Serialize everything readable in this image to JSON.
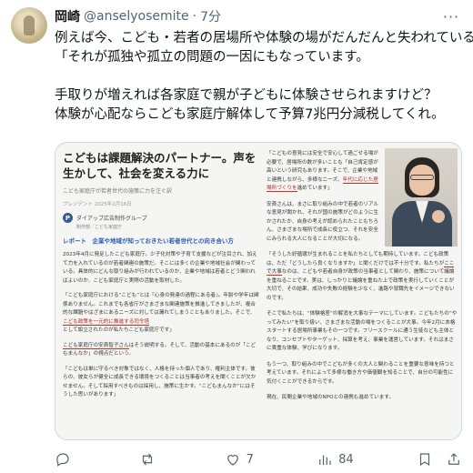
{
  "tweet": {
    "author_name": "岡崎",
    "handle": "@anselyosemite",
    "separator": "·",
    "time": "7分",
    "more_icon": "more-dots-icon",
    "lines": [
      "例えば今、こども・若者の居場所や体験の場がだんだんと失われている。",
      "「それが孤独や孤立の問題の一因にもなっています。",
      "手取りが増えれば各家庭で親が子どもに体験させられますけど？",
      "体験が心配ならこども家庭庁解体して予算7兆円分減税してくれ。"
    ]
  },
  "article": {
    "title": "こどもは課題解決のパートナー。声を生かして、社会を変える力に",
    "subtitle": "こども家庭庁が若者世代の施策に力を注ぐ訳",
    "date": "プレジデント 2025年2月16日",
    "publisher_logo": "P",
    "publisher": "ダイアップ広告制作グループ",
    "publisher_dept": "制作部／こども家庭庁",
    "report_label": "レポート　企業や地域が知っておきたい若者世代との向き合い方",
    "left_para1": "2023年4月に発足したこども家庭庁。少子化対策や子育て支援などが注目され、加えて力を入れているのが若者関連の施策だ。そこには多くの企業や地域社会が関わっている。具体的にどんな取り組みが行われているのか、企業や地域は若者とどう関わればよいのか、こども家庭庁と実際の活動を取材した。",
    "left_para2": "「こども家庭庁における“こども”とは『心身の発達の過程にある者』。年齢や学年は関係ありません。これまでも各省庁がさまざまな関連施策を推進してきましたが、複合的な課題やはざまにあるニーズに対しては漏れてしまうこともありました。そこで、",
    "left_para2_underline": "こども政策を一元的に推進する司令塔",
    "left_para2_tail": "として設立されたのが私たちこども家庭庁です」",
    "left_para3_underline": "こども家庭庁の安斎智子さん",
    "left_para3_tail": "はそう説明する。そして、活動の基本にあるのが「こどもまんなか」の視点だという。",
    "left_para4": "「こどもは単に守るべき対象ではなく、人格を持った個人であり、権利主体です。彼らの、彼女らが健全に成長できる環境をつくることは当事者の考えを聞くことが欠かせません。そして採用すべきものは採用し、施策に生かす。“こどもまんなか”にはそうした思いがあります」",
    "right_para1": "「こどもの意見には安全で安心して過ごせる場が必要で、居場所の数が多いことも「自己肯定感が高いという研究もあります。そこで、企業や地域と連携しながら、多様なニーズ、",
    "right_para1_underline": "年代に応じた居場所づくりを",
    "right_para1_tail": "進めています」",
    "right_para2": "安斎さんは、まさに取り組みの中で若者のリアルな意見が聞かれ、それが国の施策がどのように生かされたか、自身の考えが認められたこともちろん、さまざまな場所で成長に役立つ、それを安全にみられる大人になることが大切になる。",
    "right_para3a": "「そうした好循環が生まれることを私たちとしても期待しています。こども政策は、ただ「どうしたら良くなりますか」と聞くだけでは不十分です。私たちが",
    "right_para3_underline": "ここで大事",
    "right_para3b": "なのは、こどもや若者自身が政策の当事者として関わり、施策について議論を重ねることです。実は、しっかりと議論を重ねた上で政策を実行していくことが大切で、その結果、成功や失敗の経験を少なく、進路や就職先をイメージできないのです。",
    "right_para4": "そこで私たちは、“体験格差”の解消を大事なテーマにしています。こどもたちの”やってみたい”を取り扱い、さまざまな活動の場をつくることが大事。今年2月に本格スタートする居場所事業もその一つです。フリースクールに通う生徒なども主体となり、コンセプトやターゲット、採算を考え、事業を運営しています。それはまさに貴重な体験、学びになります。",
    "right_para5": "もう一つ、取り組みの中でこどもが多くの大人と関わることを重要な意味を持つと考えています。それによって多様な働き方や価値観を知ることで、自分の可能性に気付くことができるからです。",
    "right_para6": "現在、民間企業や地域のNPOとの連携も進めています。"
  },
  "actions": {
    "reply": {
      "icon": "reply-icon",
      "count": ""
    },
    "retweet": {
      "icon": "retweet-icon",
      "count": ""
    },
    "like": {
      "icon": "heart-icon",
      "count": "7"
    },
    "views": {
      "icon": "views-icon",
      "count": "84"
    },
    "bookmark": {
      "icon": "bookmark-icon",
      "count": ""
    },
    "share": {
      "icon": "share-icon",
      "count": ""
    }
  },
  "colors": {
    "text": "#0f1419",
    "muted": "#536471",
    "border": "#cfd9de",
    "accent_link": "#2a5db0",
    "underline_red": "#d9271c"
  }
}
